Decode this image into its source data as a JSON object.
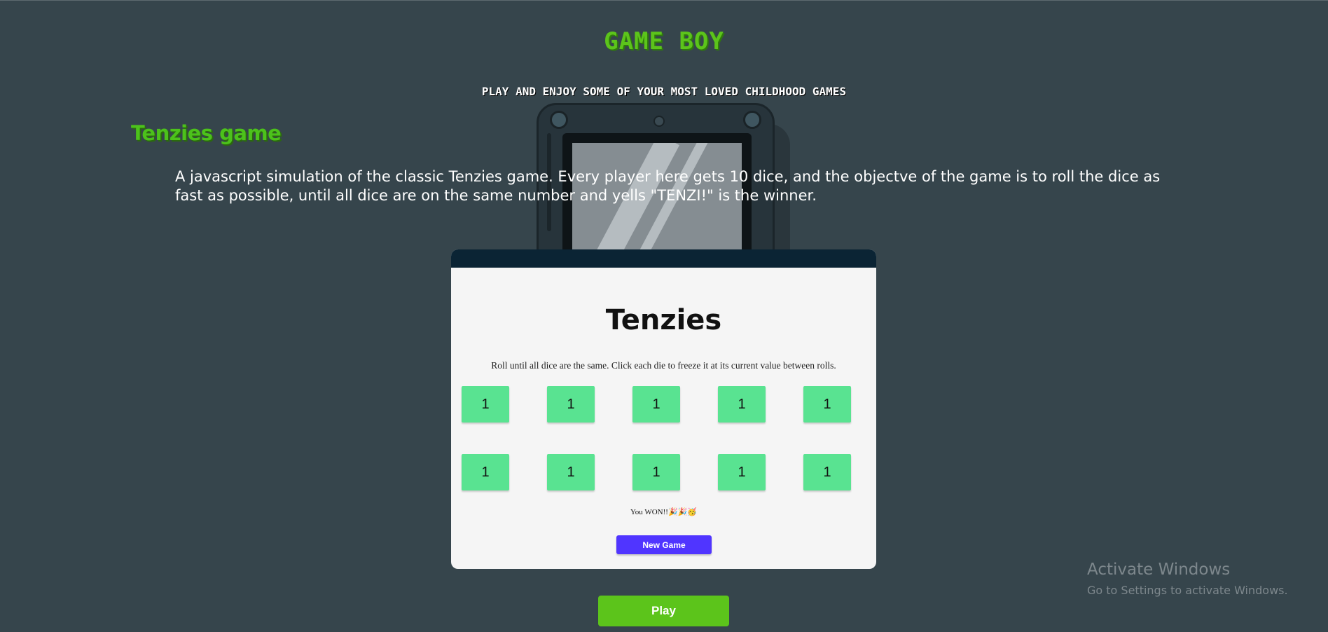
{
  "header": {
    "title": "GAME BOY",
    "subtitle": "PLAY AND ENJOY SOME OF YOUR MOST LOVED CHILDHOOD GAMES"
  },
  "game_section": {
    "title": "Tenzies game",
    "description": "A javascript simulation of the classic Tenzies game. Every player here gets 10 dice, and the objectve of the game is to roll the dice as fast as possible, until all dice are on the same number and yells \"TENZI!\" is the winner."
  },
  "tenzies": {
    "heading": "Tenzies",
    "instructions": "Roll until all dice are the same. Click each die to freeze it at its current value between rolls.",
    "dice": [
      "1",
      "1",
      "1",
      "1",
      "1",
      "1",
      "1",
      "1",
      "1",
      "1"
    ],
    "die_color": "#59e391",
    "win_text": "You WON!!",
    "win_emoji": "🎉🎉🥳",
    "new_game_label": "New Game"
  },
  "play_button_label": "Play",
  "windows_watermark": {
    "title": "Activate Windows",
    "subtitle": "Go to Settings to activate Windows."
  },
  "colors": {
    "background": "#36454c",
    "accent_green": "#5cc41b",
    "new_game_purple": "#5035ff",
    "frame_bar": "#0b2434"
  },
  "icons": {
    "illustration": "gameboy-illustration"
  }
}
